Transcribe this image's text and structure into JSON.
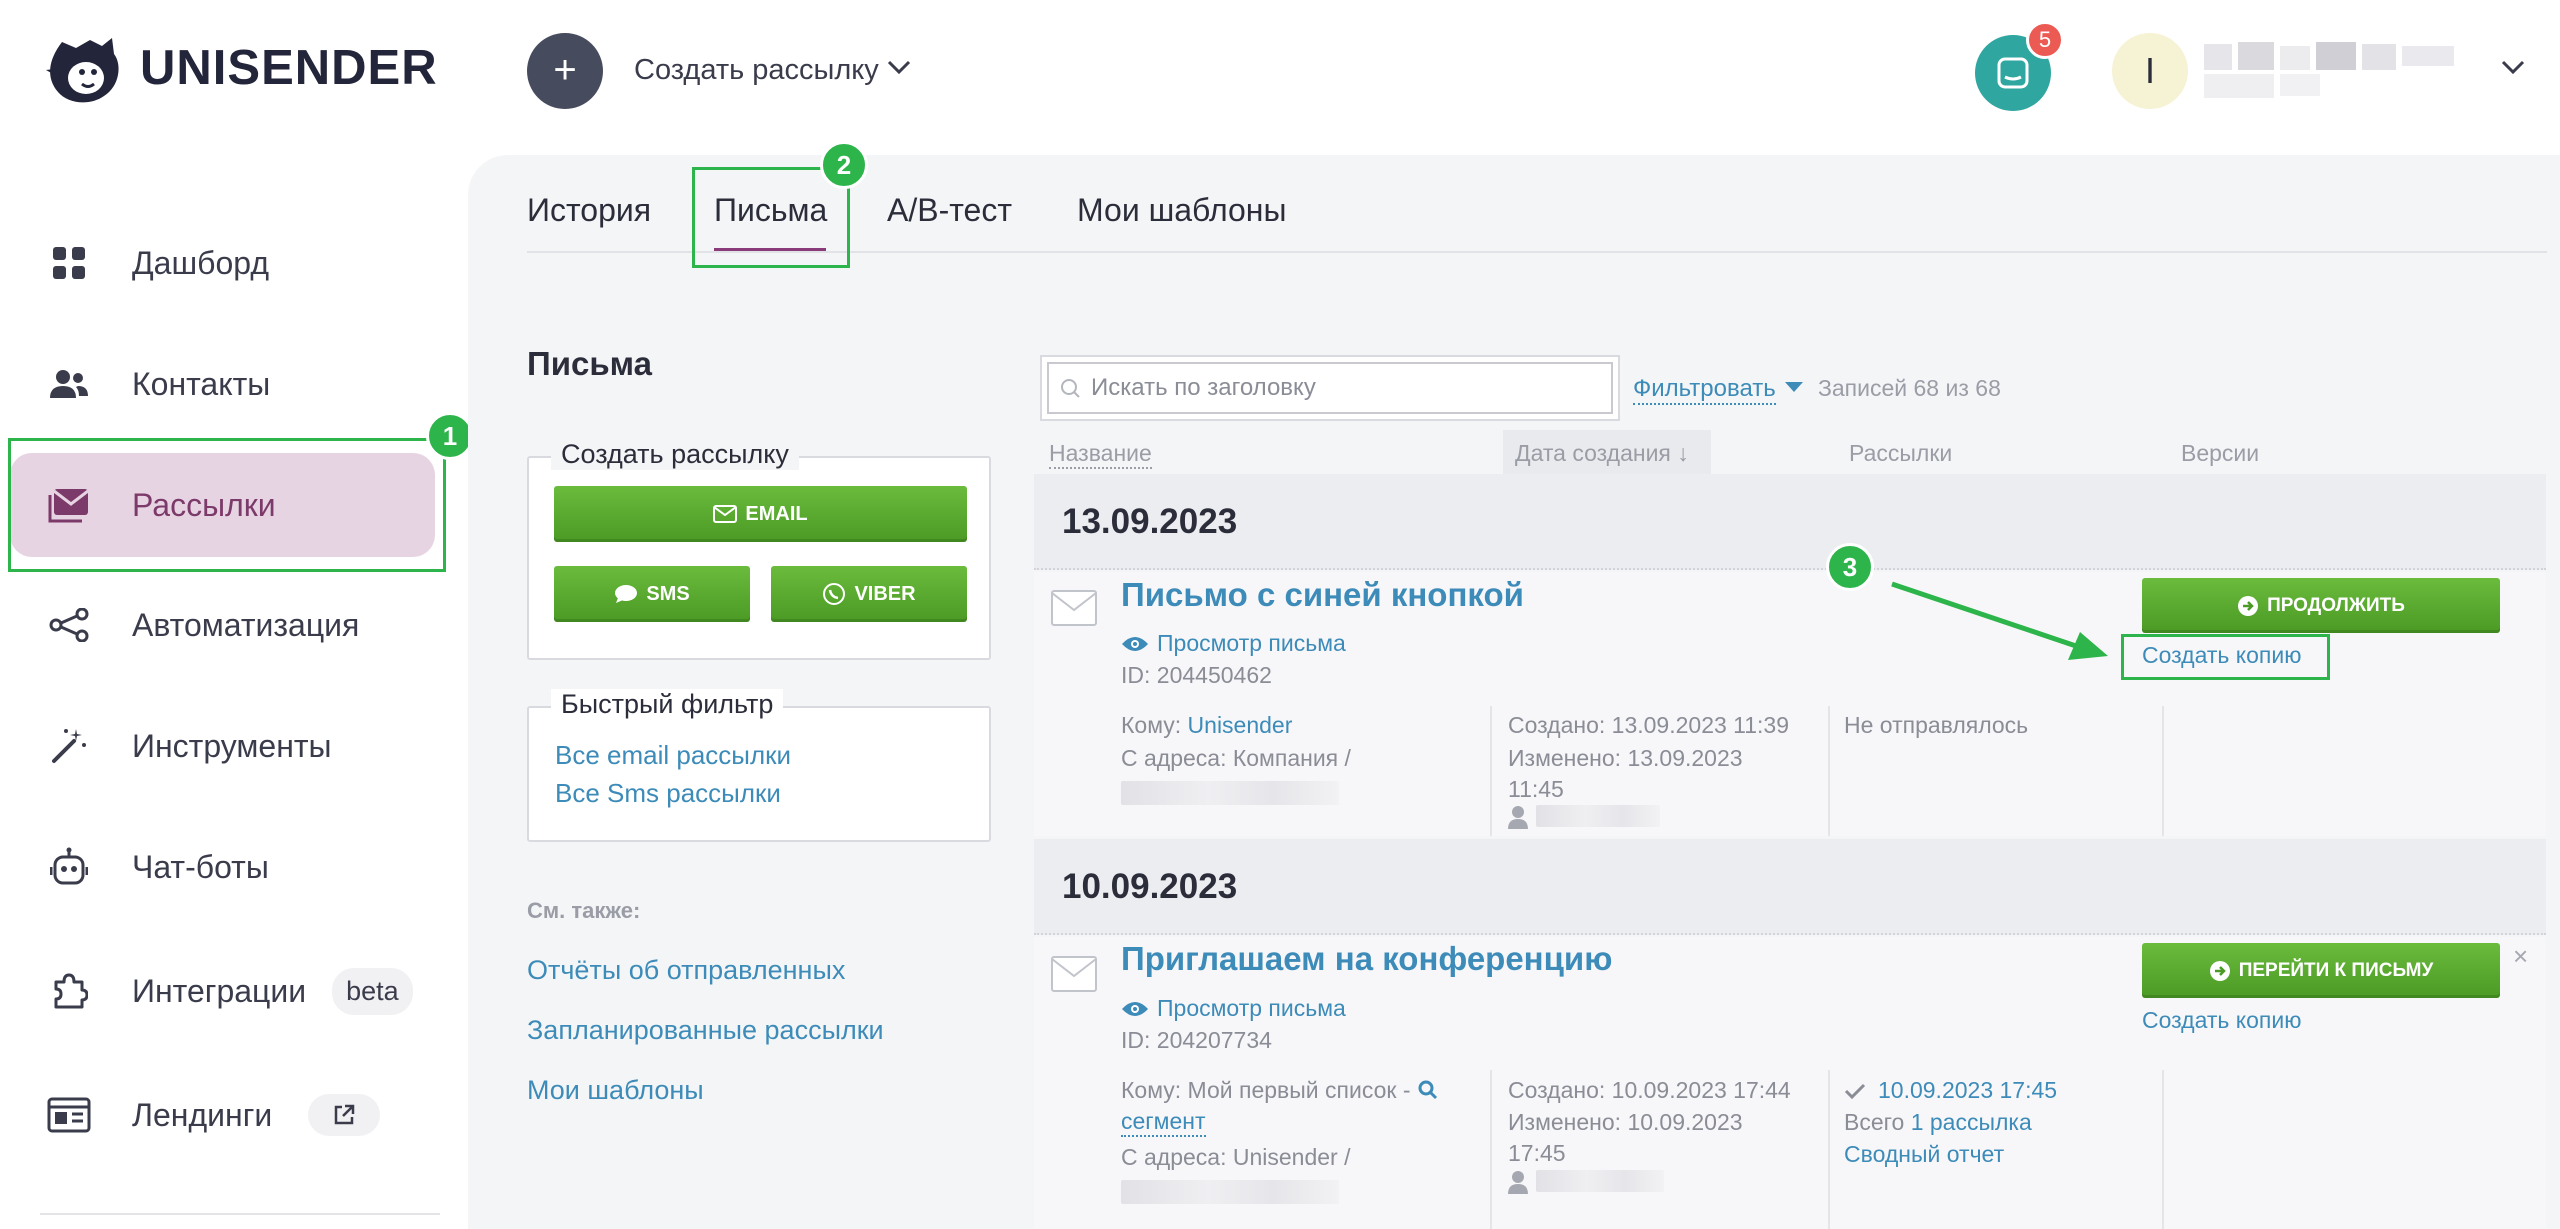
{
  "app": {
    "logo_text": "UNISENDER"
  },
  "header": {
    "create_label": "Создать рассылку",
    "notifications_count": "5",
    "avatar_letter": "I"
  },
  "sidebar": {
    "items": [
      {
        "label": "Дашборд",
        "icon": "dashboard-icon"
      },
      {
        "label": "Контакты",
        "icon": "contacts-icon"
      },
      {
        "label": "Рассылки",
        "icon": "mailing-icon",
        "active": true
      },
      {
        "label": "Автоматизация",
        "icon": "automation-icon"
      },
      {
        "label": "Инструменты",
        "icon": "magic-wand-icon"
      },
      {
        "label": "Чат-боты",
        "icon": "bot-icon"
      },
      {
        "label": "Интеграции",
        "icon": "puzzle-icon",
        "badge": "beta"
      },
      {
        "label": "Лендинги",
        "icon": "landing-icon",
        "external": true
      }
    ]
  },
  "annotations": {
    "step1": "1",
    "step2": "2",
    "step3": "3",
    "accent": "#2db54b"
  },
  "tabs": [
    {
      "label": "История"
    },
    {
      "label": "Письма",
      "active": true
    },
    {
      "label": "A/B-тест"
    },
    {
      "label": "Мои шаблоны"
    }
  ],
  "left_panel": {
    "title": "Письма",
    "create_box": {
      "legend": "Создать рассылку",
      "email": "EMAIL",
      "sms": "SMS",
      "viber": "VIBER"
    },
    "quick_filter": {
      "legend": "Быстрый фильтр",
      "links": [
        "Все email рассылки",
        "Все Sms рассылки"
      ]
    },
    "see_also": {
      "label": "См. также:",
      "links": [
        "Отчёты об отправленных",
        "Запланированные рассылки",
        "Мои шаблоны"
      ]
    }
  },
  "toolbar": {
    "search_placeholder": "Искать по заголовку",
    "filter_label": "Фильтровать",
    "records": "Записей 68 из 68"
  },
  "table": {
    "columns": [
      "Название",
      "Дата создания ↓",
      "Рассылки",
      "Версии"
    ],
    "groups": [
      {
        "date": "13.09.2023",
        "letter": {
          "title": "Письмо с синей кнопкой",
          "preview": "Просмотр письма",
          "id": "ID: 204450462",
          "to_label": "Кому:",
          "to_value": "Unisender",
          "from": "С адреса: Компания /",
          "created": "Создано: 13.09.2023 11:39",
          "modified_1": "Изменено: 13.09.2023",
          "modified_2": "11:45",
          "status": "Не отправлялось",
          "action": "ПРОДОЛЖИТЬ",
          "copy": "Создать копию"
        }
      },
      {
        "date": "10.09.2023",
        "letter": {
          "title": "Приглашаем на конференцию",
          "preview": "Просмотр письма",
          "id": "ID: 204207734",
          "to_label": "Кому: Мой первый список -",
          "to_value": "сегмент",
          "from": "С адреса: Unisender /",
          "created": "Создано: 10.09.2023 17:44",
          "modified_1": "Изменено: 10.09.2023",
          "modified_2": "17:45",
          "sent_date": "10.09.2023 17:45",
          "total_label": "Всего",
          "total_link": "1 рассылка",
          "report": "Сводный отчет",
          "action": "ПЕРЕЙТИ К ПИСЬМУ",
          "copy": "Создать копию",
          "close": "×"
        }
      }
    ]
  }
}
